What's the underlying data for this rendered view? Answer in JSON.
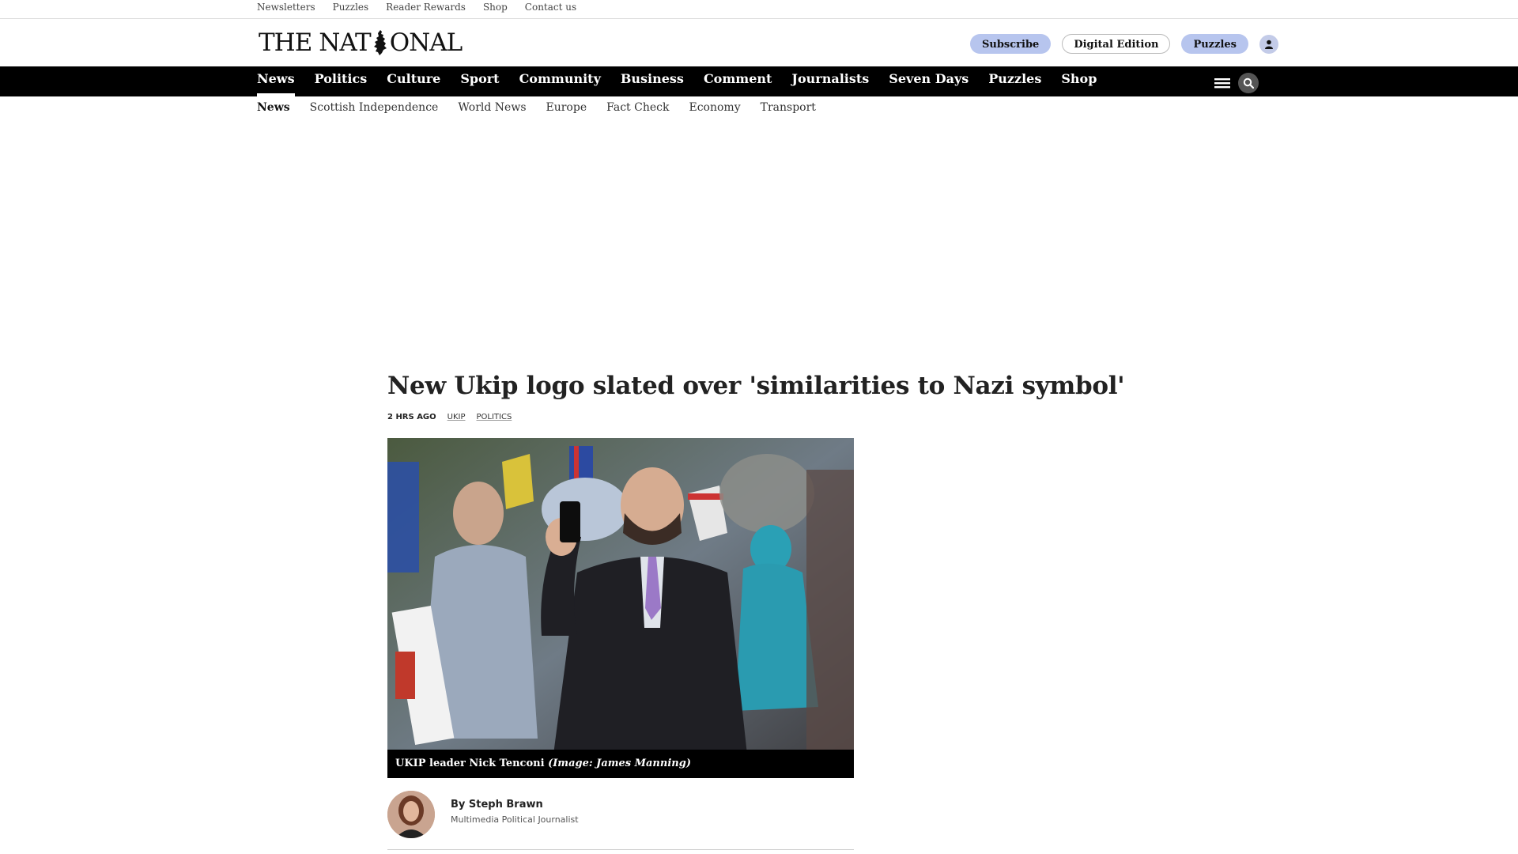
{
  "utility": {
    "links": [
      "Newsletters",
      "Puzzles",
      "Reader Rewards",
      "Shop",
      "Contact us"
    ]
  },
  "masthead": {
    "logo_left": "THE NAT",
    "logo_right": "ONAL",
    "subscribe": "Subscribe",
    "digital_edition": "Digital Edition",
    "puzzles": "Puzzles"
  },
  "nav": {
    "items": [
      "News",
      "Politics",
      "Culture",
      "Sport",
      "Community",
      "Business",
      "Comment",
      "Journalists",
      "Seven Days",
      "Puzzles",
      "Shop"
    ],
    "active": "News"
  },
  "subnav": {
    "items": [
      "News",
      "Scottish Independence",
      "World News",
      "Europe",
      "Fact Check",
      "Economy",
      "Transport"
    ],
    "active": "News"
  },
  "article": {
    "headline": "New Ukip logo slated over 'similarities to Nazi symbol'",
    "time": "2 HRS AGO",
    "tags": [
      "UKIP",
      "POLITICS"
    ],
    "caption_main": "UKIP leader Nick Tenconi ",
    "caption_credit": "(Image: James Manning)",
    "author": "By Steph Brawn",
    "author_role": "Multimedia Political Journalist"
  },
  "icons": {
    "menu": "hamburger-menu-icon",
    "search": "search-icon",
    "user": "user-icon"
  },
  "colors": {
    "nav_bg": "#000000",
    "pill_blue": "#b7c5ee"
  }
}
